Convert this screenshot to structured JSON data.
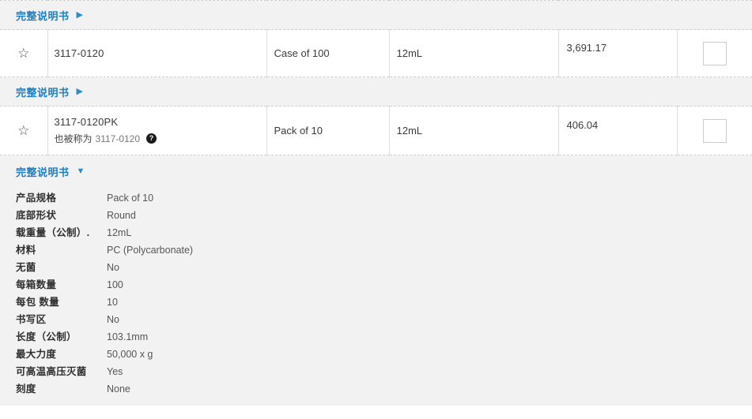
{
  "sections": {
    "top_strip": {
      "link_label": "完整说明书",
      "toggle_icon": "triangle-right-icon",
      "toggle_glyph": "▶"
    },
    "middle_strip": {
      "link_label": "完整说明书",
      "toggle_icon": "triangle-right-icon",
      "toggle_glyph": "▶"
    },
    "expanded_panel": {
      "link_label": "完整说明书",
      "toggle_icon": "triangle-down-icon",
      "toggle_glyph": "▼"
    }
  },
  "rows": [
    {
      "favorite_icon": "star-icon",
      "favorite_glyph": "☆",
      "sku": "3117-0120",
      "alias_prefix": null,
      "alias_value": null,
      "help_icon": null,
      "help_glyph": null,
      "pack": "Case of 100",
      "volume": "12mL",
      "price": "3,691.17",
      "checkbox_checked": false
    },
    {
      "favorite_icon": "star-icon",
      "favorite_glyph": "☆",
      "sku": "3117-0120PK",
      "alias_prefix": "也被称为",
      "alias_value": "3117-0120",
      "help_icon": "help-circle-icon",
      "help_glyph": "?",
      "pack": "Pack of 10",
      "volume": "12mL",
      "price": "406.04",
      "checkbox_checked": false
    }
  ],
  "specifications": [
    {
      "label": "产品规格",
      "value": "Pack of 10"
    },
    {
      "label": "底部形状",
      "value": "Round"
    },
    {
      "label": "载重量（公制）.",
      "value": "12mL"
    },
    {
      "label": "材料",
      "value": "PC (Polycarbonate)"
    },
    {
      "label": "无菌",
      "value": "No"
    },
    {
      "label": "每箱数量",
      "value": "100"
    },
    {
      "label": "每包 数量",
      "value": "10"
    },
    {
      "label": "书写区",
      "value": "No"
    },
    {
      "label": "长度（公制）",
      "value": "103.1mm"
    },
    {
      "label": "最大力度",
      "value": "50,000 x g"
    },
    {
      "label": "可高温高压灭菌",
      "value": "Yes"
    },
    {
      "label": "刻度",
      "value": "None"
    }
  ],
  "colors": {
    "link_blue": "#1c7fc4",
    "panel_background": "#f2f2f2",
    "row_background": "#ffffff",
    "border_dashed": "#cfcfcf",
    "border_solid": "#dddddd",
    "text_primary": "#3a3a3a",
    "text_muted": "#777777"
  }
}
